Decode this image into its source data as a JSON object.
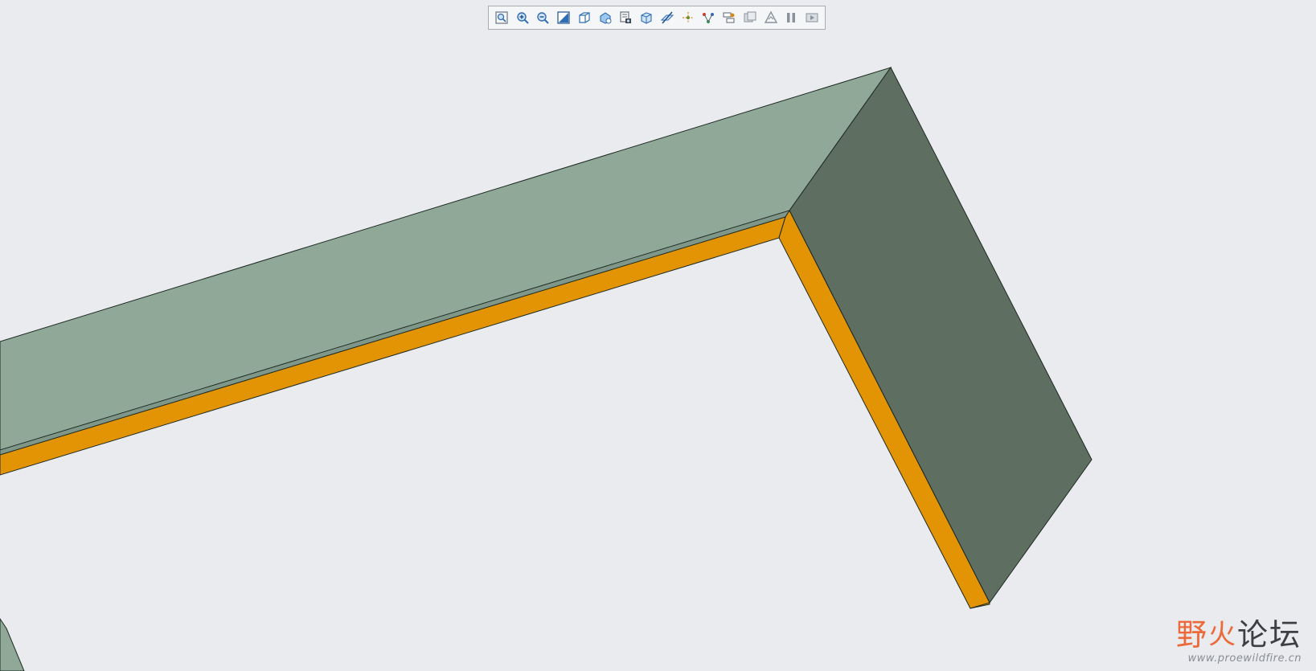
{
  "colors": {
    "background": "#e9ebee",
    "top_face": "#8fa898",
    "side_face": "#5e6f62",
    "edge_face": "#e39405",
    "outline": "#1e2a22"
  },
  "toolbar": {
    "buttons": [
      {
        "name": "refit",
        "icon": "zoom-fit-icon"
      },
      {
        "name": "zoom-in",
        "icon": "zoom-in-icon"
      },
      {
        "name": "zoom-out",
        "icon": "zoom-out-icon"
      },
      {
        "name": "repaint",
        "icon": "repaint-icon"
      },
      {
        "name": "display-style",
        "icon": "display-style-icon"
      },
      {
        "name": "saved-orientations",
        "icon": "saved-orientations-icon"
      },
      {
        "name": "view-manager",
        "icon": "view-manager-icon"
      },
      {
        "name": "perspective-view",
        "icon": "perspective-icon"
      },
      {
        "name": "section",
        "icon": "section-icon"
      },
      {
        "name": "datum-display",
        "icon": "datum-display-icon"
      },
      {
        "name": "annotation-display",
        "icon": "annotation-display-icon"
      },
      {
        "name": "spin-center",
        "icon": "spin-center-icon"
      },
      {
        "name": "appearance",
        "icon": "appearance-icon"
      },
      {
        "name": "regenerate",
        "icon": "regenerate-icon"
      },
      {
        "name": "pause",
        "icon": "pause-icon"
      },
      {
        "name": "next",
        "icon": "next-icon"
      }
    ]
  },
  "watermark": {
    "chars_a": "野",
    "chars_b": "火",
    "chars_c": "论坛",
    "url": "www.proewildfire.cn"
  }
}
